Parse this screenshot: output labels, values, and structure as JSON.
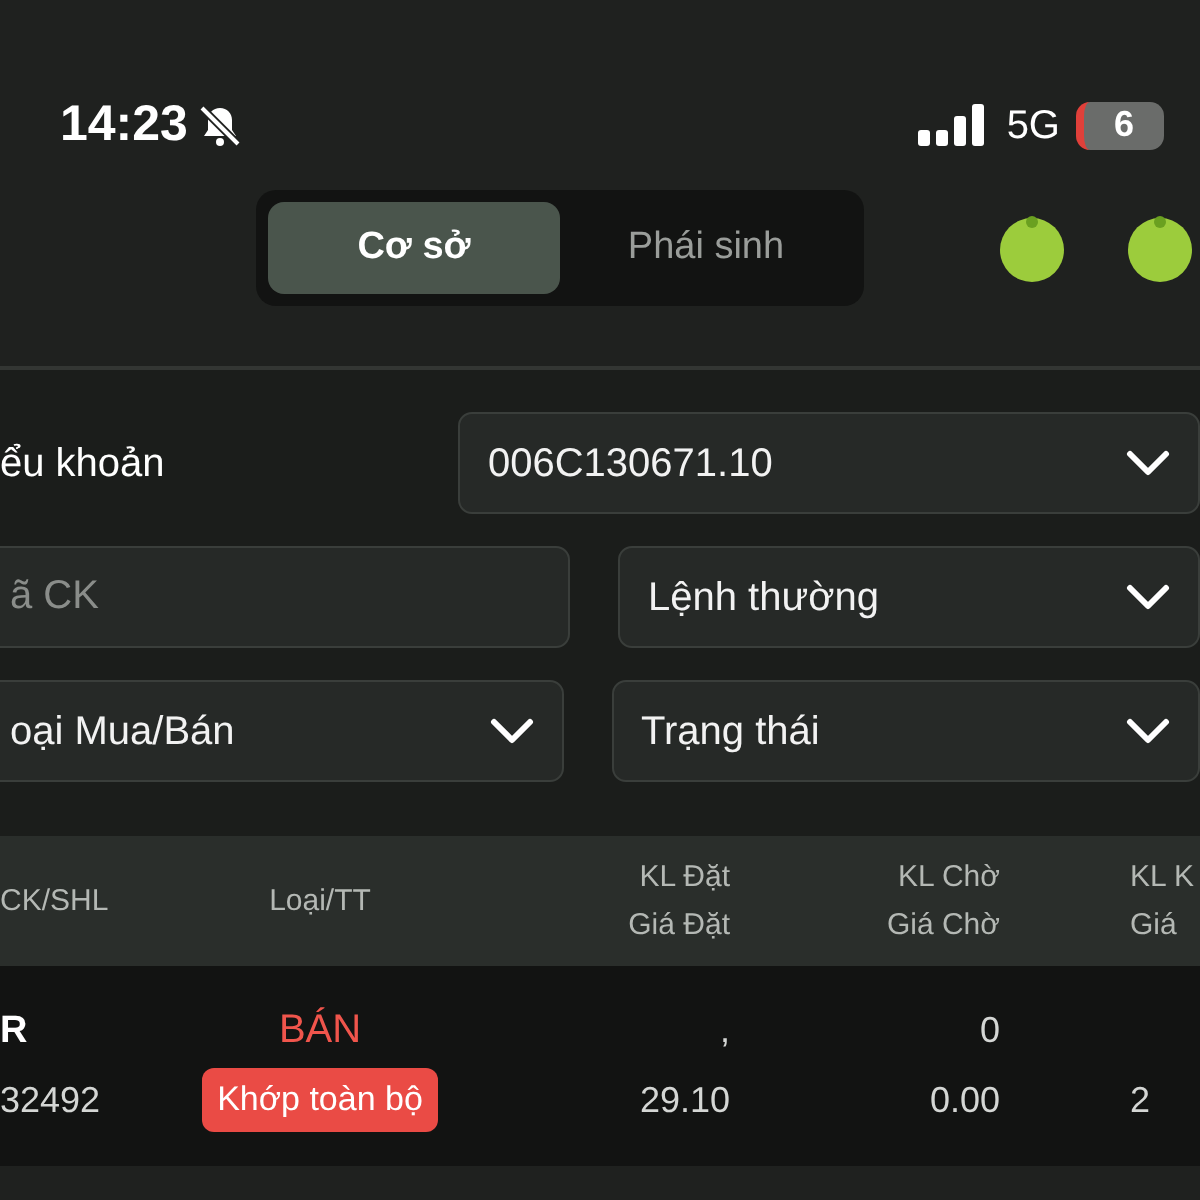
{
  "status_bar": {
    "time": "14:23",
    "network": "5G",
    "battery": "6"
  },
  "tabs": [
    {
      "label": "Cơ sở",
      "selected": true
    },
    {
      "label": "Phái sinh",
      "selected": false
    }
  ],
  "filters": {
    "account_label": "ểu khoản",
    "account": "006C130671.10",
    "symbol": {
      "placeholder": "ã CK"
    },
    "order_type": "Lệnh thường",
    "side": "oại Mua/Bán",
    "status": "Trạng thái"
  },
  "table": {
    "columns": [
      [
        "CK/SHL"
      ],
      [
        "Loại/TT"
      ],
      [
        "KL Đặt",
        "Giá Đặt"
      ],
      [
        "KL Chờ",
        "Giá Chờ"
      ],
      [
        "KL K",
        "Giá"
      ]
    ],
    "rows": [
      {
        "symbol": "R",
        "shl": "32492",
        "side": "BÁN",
        "status": "Khớp toàn bộ",
        "kl_dat": ",",
        "gia_dat": "29.10",
        "kl_cho": "0",
        "gia_cho": "0.00",
        "column_5": "2"
      }
    ]
  }
}
